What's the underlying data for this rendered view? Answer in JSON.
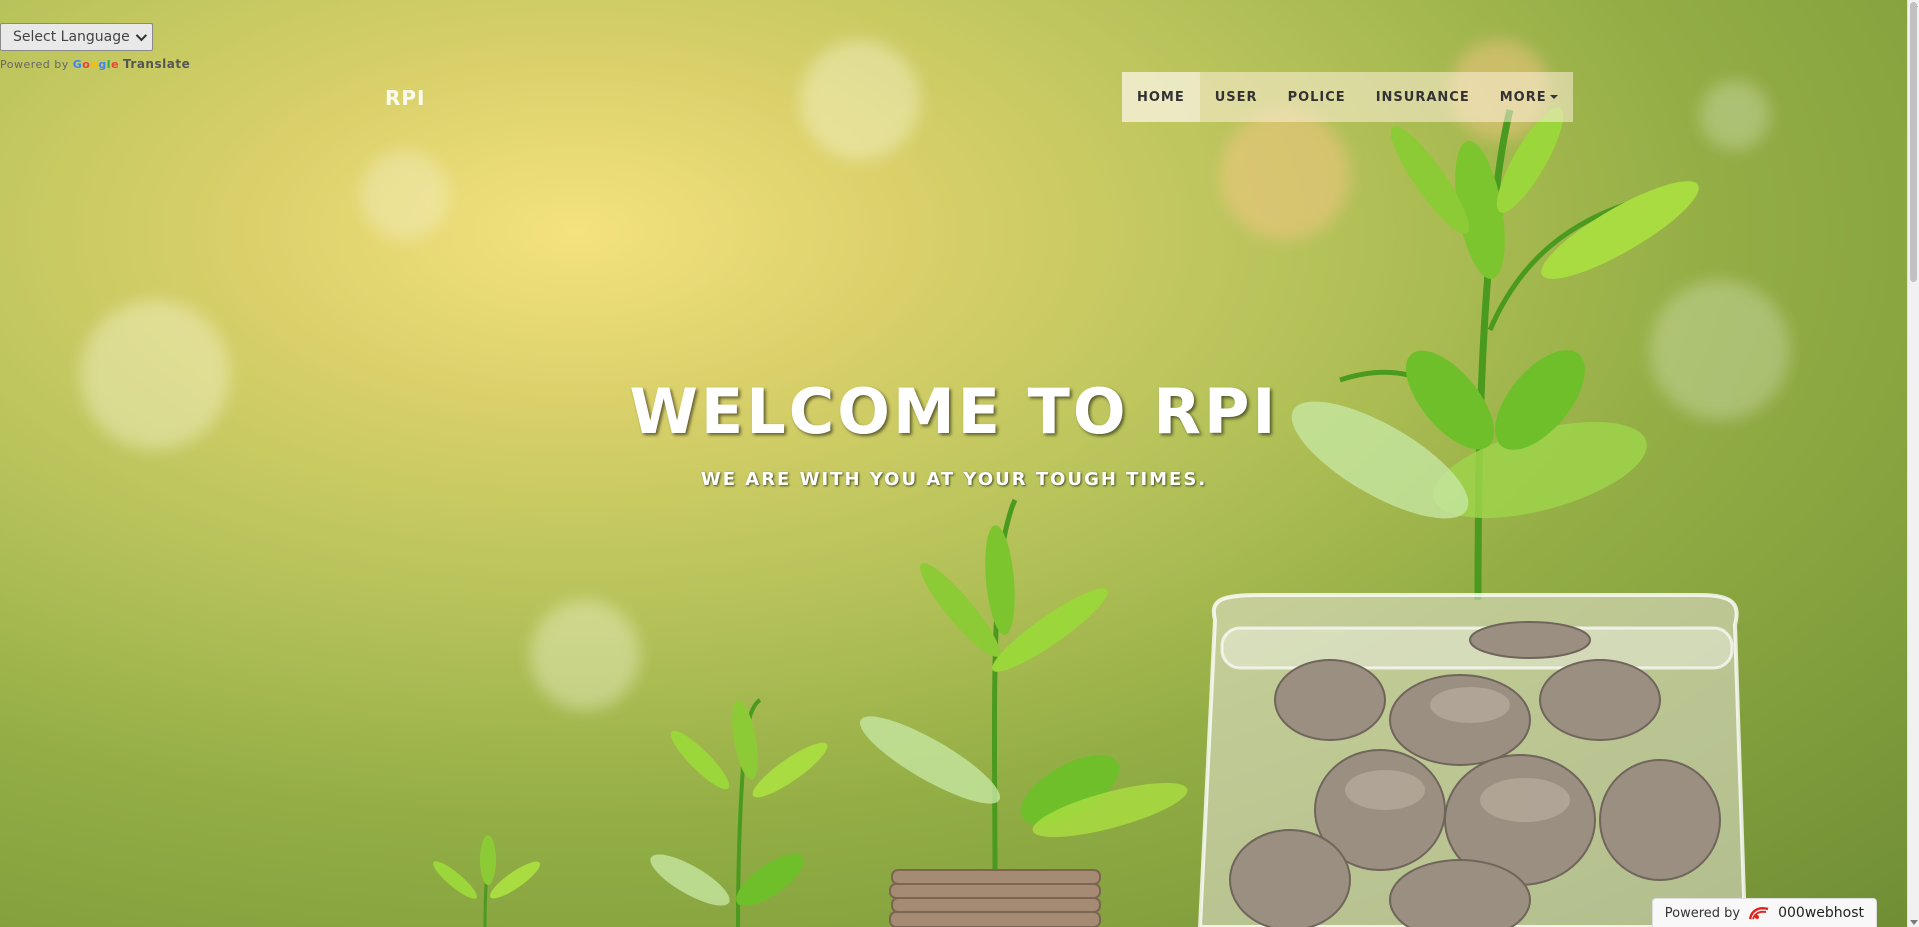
{
  "translate": {
    "select_label": "Select Language",
    "powered_by": "Powered by",
    "google": "Google",
    "translate_word": "Translate"
  },
  "brand": {
    "name": "RPI"
  },
  "nav": {
    "items": [
      {
        "label": "HOME",
        "active": true
      },
      {
        "label": "USER"
      },
      {
        "label": "POLICE"
      },
      {
        "label": "INSURANCE"
      },
      {
        "label": "MORE",
        "dropdown": true
      }
    ]
  },
  "hero": {
    "title": "WELCOME TO RPI",
    "subtitle": "WE ARE WITH YOU AT YOUR TOUGH TIMES."
  },
  "hosting_badge": {
    "powered_by": "Powered by",
    "host_name": "000webhost",
    "icon": "webhost-logo-icon"
  },
  "colors": {
    "nav_text": "#333333",
    "hero_text": "#ffffff",
    "leaf_green": "#6cc02b"
  }
}
